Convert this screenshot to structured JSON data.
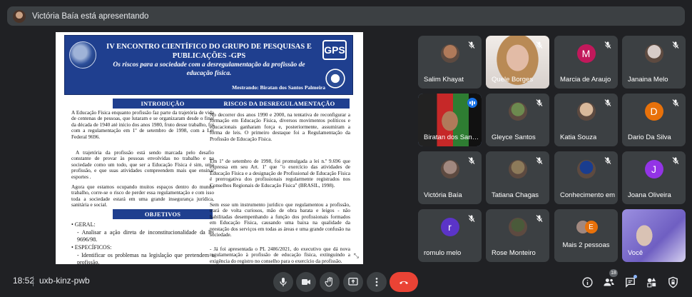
{
  "banner": {
    "presenter_text": "Victória Baía está apresentando"
  },
  "slide": {
    "title": "IV ENCONTRO CIENTÍFICO DO GRUPO DE PESQUISAS E PUBLICAÇÕES -GPS",
    "subtitle": "Os riscos para a sociedade com a desregulamentação da profissão de educação física.",
    "author": "Mestrando: Biratan dos Santos Palmeira",
    "gps_logo": "GPS",
    "intro_heading": "INTRODUÇÃO",
    "intro_p1": "A Educação Física enquanto profissão faz parte da trajetória de vida de centenas de pessoas, que lutaram e se organizaram desde o final da década de 1940 até início dos anos 1980, fruto desse trabalho, foi com a regulamentação em 1º de setembro de 1998, com a Lei Federal 9696.",
    "intro_p2": "A trajetória da profissão está sendo marcada pelo desafio constante de provar às pessoas envolvidas no trabalho e na sociedade como um todo, que ser a Educação Física é sim, uma profissão, e que suas atividades compreendem mais que ensinar esportes .",
    "intro_p3": "Agora que estamos ocupando muitos espaços dentro do mundo trabalho, corre-se o risco de perder essa regulamentação e com isso toda a sociedade estará em uma grande insegurança jurídica, sanitária e social.",
    "objectives_heading": "OBJETIVOS",
    "obj_general": "• GERAL:",
    "obj_general_text": "- Analisar a ação direta de inconstitucionalidade da lei 9696/98.",
    "obj_specific": "• ESPECÍFICOS:",
    "obj_specific_text": "- Identificar os problemas na legislação que pretendem a profissão.",
    "risks_heading": "RISCOS DA DESREGULAMENTAÇÃO",
    "risks_p1": "No decorrer dos anos 1990 e 2000, na tentativa de reconfigurar a formação em Educação Física, diversos movimentos políticos e educacionais ganharam força e, posteriormente, assumiram a forma de leis. O primeiro destaque foi a Regulamentação da Profissão de Educação Física.",
    "risks_p2": "Em 1º de setembro de 1998, foi promulgada a lei n.º 9.696 que expressa em seu Art. 1º que \"o exercício das atividades de Educação Física e a designação de Profissional de Educação Física é prerrogativa dos profissionais regularmente registrados nos Conselhos Regionais de Educação Física\" (BRASIL, 1998).",
    "risks_p3": "Sem esse um instrumento jurídico que regulamentou a profissão, trará de volta curiosos, mão de obra barata e leigos - não habilitadas desempenhando a função dos profissionais formados em Educação Física, causando uma baixa na qualidade da prestação dos serviços em todas as áreas e uma grande confusão na sociedade.",
    "risks_p4": "- Já foi apresentada o PL 2486/2021, do executivo que dá nova regulamentação à profissão de educação física, extinguindo a exigência do registro no conselho para o exercício da profissão."
  },
  "participants": [
    {
      "name": "Salim Khayat",
      "kind": "photo",
      "color": "#b07a5a"
    },
    {
      "name": "Quele Borges",
      "kind": "video",
      "color": "#c79b86"
    },
    {
      "name": "Marcia de Araujo",
      "kind": "letter",
      "letter": "M",
      "color": "#c2185b"
    },
    {
      "name": "Janaina Melo",
      "kind": "photo",
      "color": "#d7ccc8"
    },
    {
      "name": "Biratan dos Santos",
      "kind": "active",
      "color": "#9e4a2e"
    },
    {
      "name": "Gleyce Santos",
      "kind": "photo",
      "color": "#6d8a4f"
    },
    {
      "name": "Katia Souza",
      "kind": "photo",
      "color": "#d9b99b"
    },
    {
      "name": "Dario Da Silva",
      "kind": "letter",
      "letter": "D",
      "color": "#e8710a"
    },
    {
      "name": "Victória Baía",
      "kind": "photo",
      "color": "#a1887f"
    },
    {
      "name": "Tatiana Chagas",
      "kind": "photo",
      "color": "#8d7a5a"
    },
    {
      "name": "Conhecimento em",
      "kind": "photo",
      "color": "#1a3d8f"
    },
    {
      "name": "Joana Oliveira",
      "kind": "letter",
      "letter": "J",
      "color": "#9334e6"
    },
    {
      "name": "romulo melo",
      "kind": "letter",
      "letter": "r",
      "color": "#5b34c8"
    },
    {
      "name": "Rose Monteiro",
      "kind": "photo",
      "color": "#4a5a3a"
    },
    {
      "name": "Mais 2 pessoas",
      "kind": "more",
      "letter": "E",
      "color": "#e8710a"
    },
    {
      "name": "Você",
      "kind": "self",
      "color": "#7b6cc9"
    }
  ],
  "footer": {
    "time": "18:52",
    "meeting_code": "uxb-kinz-pwb",
    "people_count": "18"
  }
}
